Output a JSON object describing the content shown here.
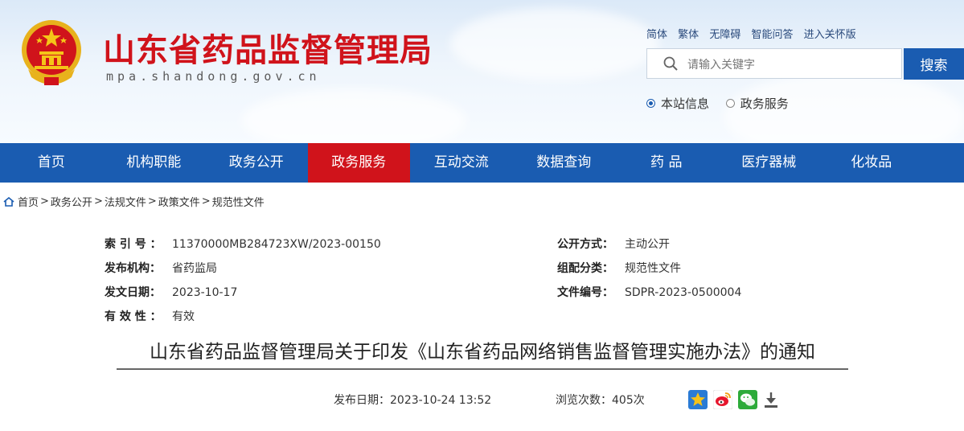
{
  "header": {
    "title": "山东省药品监督管理局",
    "domain": "mpa.shandong.gov.cn",
    "emblem_icon": "national-emblem-icon"
  },
  "toplinks": [
    "简体",
    "繁体",
    "无障碍",
    "智能问答",
    "进入关怀版"
  ],
  "search": {
    "placeholder": "请输入关键字",
    "button": "搜索",
    "scopes": [
      {
        "label": "本站信息",
        "checked": true
      },
      {
        "label": "政务服务",
        "checked": false
      }
    ]
  },
  "nav": {
    "items": [
      "首页",
      "机构职能",
      "政务公开",
      "政务服务",
      "互动交流",
      "数据查询",
      "药 品",
      "医疗器械",
      "化妆品"
    ],
    "active": "政务服务",
    "color": "#1a5cb1",
    "active_color": "#d0131b"
  },
  "breadcrumb": [
    "首页",
    "政务公开",
    "法规文件",
    "政策文件",
    "规范性文件"
  ],
  "meta": {
    "index_label": "索 引 号 ：",
    "index_value": "11370000MB284723XW/2023-00150",
    "publish_mode_label": "公开方式：",
    "publish_mode_value": "主动公开",
    "issuer_label": "发布机构：",
    "issuer_value": "省药监局",
    "category_label": "组配分类：",
    "category_value": "规范性文件",
    "doc_date_label": "发文日期：",
    "doc_date_value": "2023-10-17",
    "doc_no_label": "文件编号：",
    "doc_no_value": "SDPR-2023-0500004",
    "validity_label": "有 效 性 ：",
    "validity_value": "有效"
  },
  "document": {
    "title": "山东省药品监督管理局关于印发《山东省药品网络销售监督管理实施办法》的通知",
    "publish_date_label": "发布日期：",
    "publish_date": "2023-10-24 13:52",
    "views_label": "浏览次数：",
    "views": "405次"
  },
  "share_icons": [
    "favorite-star-icon",
    "weibo-icon",
    "wechat-icon",
    "download-icon"
  ]
}
